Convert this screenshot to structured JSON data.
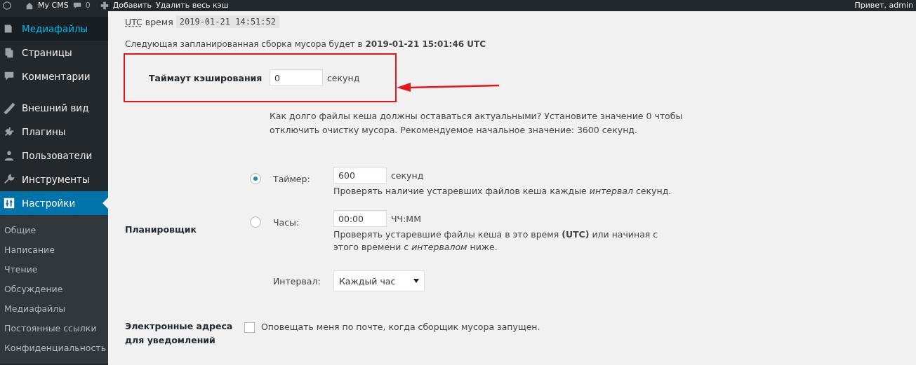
{
  "admin_bar": {
    "site": "My CMS",
    "comments": "0",
    "add": "Добавить",
    "clear_cache": "Удалить весь кэш",
    "greeting": "Привет, admin"
  },
  "sidebar": {
    "items": [
      {
        "label": "Медиафайлы",
        "selected": false,
        "highlighted": true
      },
      {
        "label": "Страницы",
        "selected": false,
        "highlighted": false
      },
      {
        "label": "Комментарии",
        "selected": false,
        "highlighted": false
      },
      {
        "label": "Внешний вид",
        "selected": false,
        "highlighted": false
      },
      {
        "label": "Плагины",
        "selected": false,
        "highlighted": false
      },
      {
        "label": "Пользователи",
        "selected": false,
        "highlighted": false
      },
      {
        "label": "Инструменты",
        "selected": false,
        "highlighted": false
      },
      {
        "label": "Настройки",
        "selected": true,
        "highlighted": false
      }
    ],
    "submenu": [
      "Общие",
      "Написание",
      "Чтение",
      "Обсуждение",
      "Медиафайлы",
      "Постоянные ссылки",
      "Конфиденциальность"
    ]
  },
  "utc": {
    "label": "UTC",
    "suffix": "время",
    "value": "2019-01-21 14:51:52"
  },
  "next_gc": "Следующая запланированная сборка мусора будет в **2019-01-21 15:01:46 UTC**",
  "timeout": {
    "label": "Таймаут кэширования",
    "value": "0",
    "unit": "секунд",
    "highlighted": true,
    "description": "Как долго файлы кеша должны оставаться актуальными? Установите значение 0 чтобы отключить очистку мусора. Рекомендуемое начальное значение: 3600 секунд."
  },
  "scheduler": {
    "label": "Планировщик",
    "options": [
      {
        "label": "Таймер:",
        "value": "600",
        "unit": "секунд",
        "selected": true,
        "description": "Проверять наличие устаревших файлов кеша каждые *интервал* секунд."
      },
      {
        "label": "Часы:",
        "value": "00:00",
        "unit": "ЧЧ:ММ",
        "selected": false,
        "description": "Проверять устаревшие файлы кеша в это время **(UTC)** или начиная с этого времени с *интервалом* ниже."
      }
    ],
    "interval": {
      "label": "Интервал:",
      "value": "Каждый час"
    }
  },
  "notify": {
    "label": "Электронные адреса для уведомлений",
    "option": "Оповещать меня по почте, когда сборщик мусора запущен.",
    "checked": false
  }
}
